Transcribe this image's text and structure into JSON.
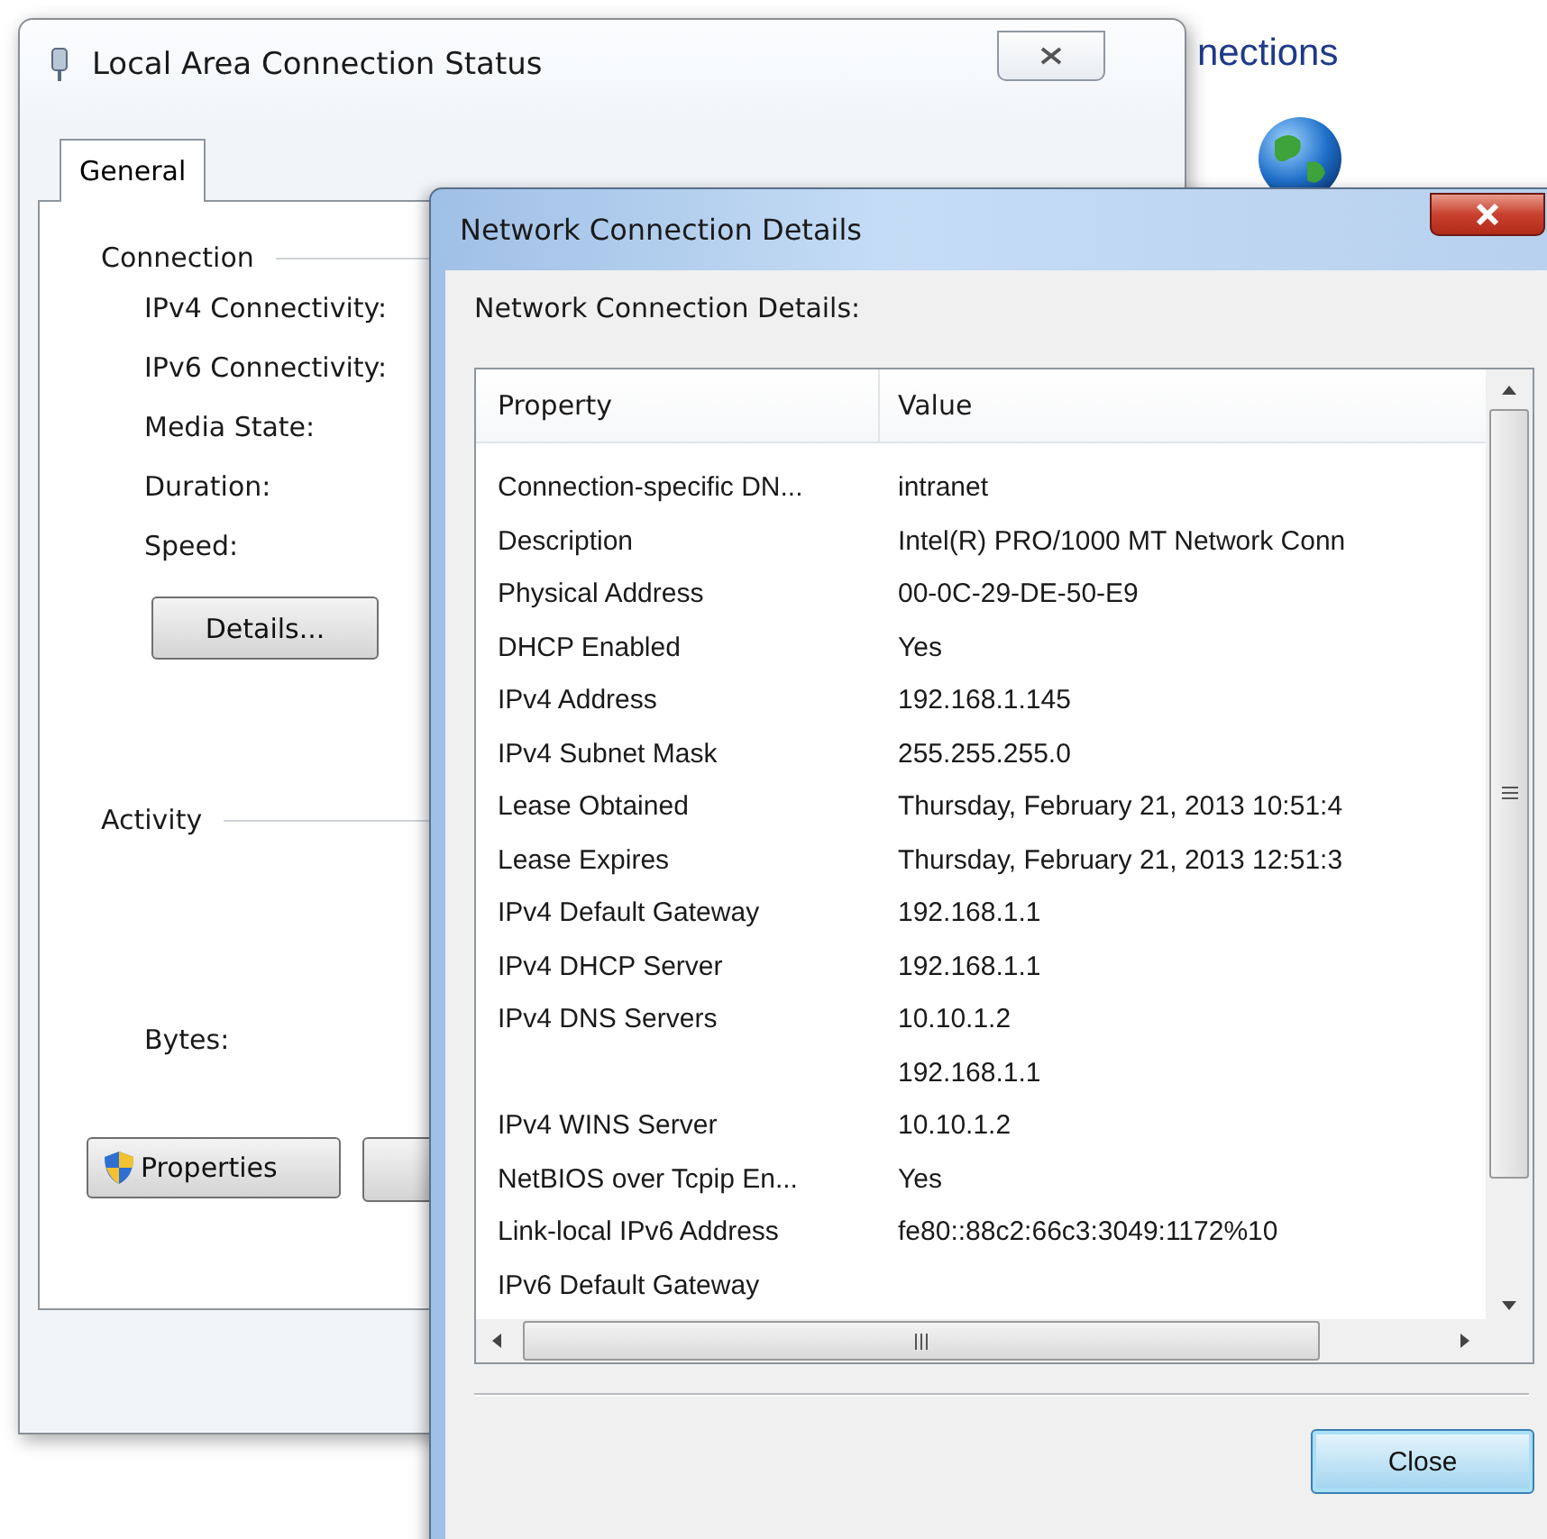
{
  "background": {
    "heading_fragment": "nections"
  },
  "status_window": {
    "title": "Local Area Connection Status",
    "tabs": [
      {
        "label": "General",
        "selected": true
      }
    ],
    "connection_group": "Connection",
    "connection_fields": [
      "IPv4 Connectivity:",
      "IPv6 Connectivity:",
      "Media State:",
      "Duration:",
      "Speed:"
    ],
    "details_button": "Details...",
    "activity_group": "Activity",
    "bytes_label": "Bytes:",
    "buttons": [
      "Properties"
    ]
  },
  "details_window": {
    "title": "Network Connection Details",
    "caption": "Network Connection Details:",
    "columns": [
      "Property",
      "Value"
    ],
    "rows": [
      {
        "property": "Connection-specific DN...",
        "value": "intranet"
      },
      {
        "property": "Description",
        "value": "Intel(R) PRO/1000 MT Network Conn"
      },
      {
        "property": "Physical Address",
        "value": "00-0C-29-DE-50-E9"
      },
      {
        "property": "DHCP Enabled",
        "value": "Yes"
      },
      {
        "property": "IPv4 Address",
        "value": "192.168.1.145"
      },
      {
        "property": "IPv4 Subnet Mask",
        "value": "255.255.255.0"
      },
      {
        "property": "Lease Obtained",
        "value": "Thursday, February 21, 2013 10:51:4"
      },
      {
        "property": "Lease Expires",
        "value": "Thursday, February 21, 2013 12:51:3"
      },
      {
        "property": "IPv4 Default Gateway",
        "value": "192.168.1.1"
      },
      {
        "property": "IPv4 DHCP Server",
        "value": "192.168.1.1"
      },
      {
        "property": "IPv4 DNS Servers",
        "value": "10.10.1.2"
      },
      {
        "value": "192.168.1.1"
      },
      {
        "property": "IPv4 WINS Server",
        "value": "10.10.1.2"
      },
      {
        "property": "NetBIOS over Tcpip En...",
        "value": "Yes"
      },
      {
        "property": "Link-local IPv6 Address",
        "value": "fe80::88c2:66c3:3049:1172%10"
      },
      {
        "property": "IPv6 Default Gateway"
      }
    ],
    "buttons": [
      {
        "label": "Close",
        "default": true
      }
    ]
  }
}
